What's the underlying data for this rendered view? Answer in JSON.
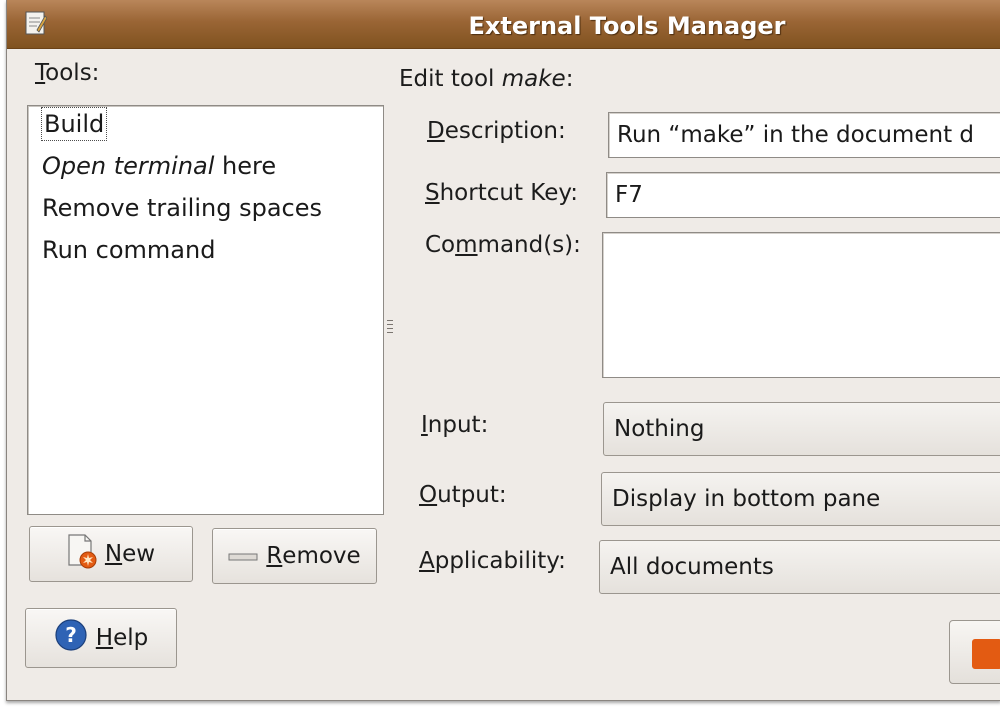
{
  "window": {
    "title": "External Tools Manager",
    "title_icon": "edit-document-icon"
  },
  "tools_panel": {
    "label_key": "T",
    "label_rest": "ools:",
    "items": [
      {
        "label": "Build",
        "selected": true,
        "italic": false
      },
      {
        "label": "Open terminal here",
        "selected": false,
        "italic": "partial"
      },
      {
        "label": "Remove trailing spaces",
        "selected": false,
        "italic": false
      },
      {
        "label": "Run command",
        "selected": false,
        "italic": false
      }
    ],
    "italic_part": "Open terminal",
    "normal_part": " here",
    "new_key": "N",
    "new_rest": "ew",
    "remove_key": "R",
    "remove_rest": "emove",
    "help_key": "H",
    "help_rest": "elp"
  },
  "edit_panel": {
    "heading_prefix": "Edit tool ",
    "heading_tool": "make",
    "heading_suffix": ":",
    "description_key": "D",
    "description_rest": "escription:",
    "description_value": "Run “make” in the document d",
    "shortcut_key": "S",
    "shortcut_rest": "hortcut Key:",
    "shortcut_value": "F7",
    "command_pre": "Co",
    "command_key": "m",
    "command_rest": "mand(s):",
    "command_value": "",
    "input_key": "I",
    "input_rest": "nput:",
    "input_value": "Nothing",
    "output_key": "O",
    "output_rest": "utput:",
    "output_value": "Display in bottom pane",
    "applicability_key": "A",
    "applicability_rest": "pplicability:",
    "applicability_value": "All documents"
  },
  "colors": {
    "titlebar": "#9a6535",
    "dialog_bg": "#efebe7",
    "accent_orange": "#e35b12",
    "help_blue": "#2f63b5"
  },
  "icons": {
    "new": "new-document-icon",
    "remove": "minus-icon",
    "help": "help-icon",
    "close": "close-icon"
  }
}
